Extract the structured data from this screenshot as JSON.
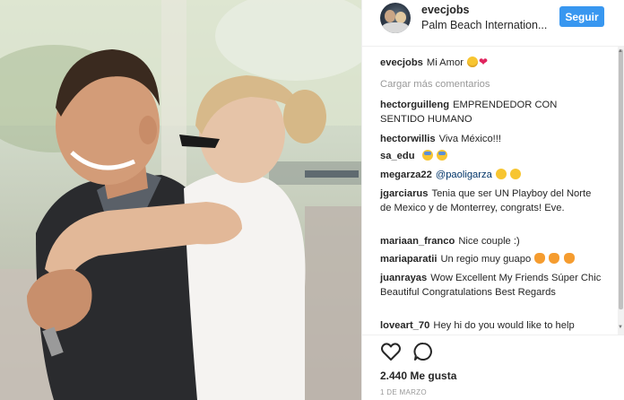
{
  "header": {
    "username": "evecjobs",
    "location": "Palm Beach Internation...",
    "follow_label": "Seguir"
  },
  "caption": {
    "username": "evecjobs",
    "text": "Mi Amor"
  },
  "load_more_label": "Cargar más comentarios",
  "comments": [
    {
      "username": "hectorguilleng",
      "text": "EMPRENDEDOR CON SENTIDO HUMANO"
    },
    {
      "username": "hectorwillis",
      "text": "Viva México!!!"
    },
    {
      "username": "sa_edu",
      "text": ""
    },
    {
      "username": "megarza22",
      "mention": "@paoligarza",
      "text": ""
    },
    {
      "username": "jgarciarus",
      "text": "Tenia que ser UN Playboy del Norte de Mexico y de Monterrey, congrats! Eve."
    },
    {
      "username": "mariaan_franco",
      "text": "Nice couple :)"
    },
    {
      "username": "mariaparatii",
      "text": "Un regio muy guapo"
    },
    {
      "username": "juanrayas",
      "text": "Wow Excellent My Friends Súper Chic Beautiful Congratulations Best Regards"
    },
    {
      "username": "loveart_70",
      "text": "Hey hi do you would like to help"
    }
  ],
  "actions": {
    "like_icon": "heart-icon",
    "comment_icon": "comment-icon"
  },
  "likes_text": "2.440 Me gusta",
  "date_text": "1 DE MARZO",
  "colors": {
    "follow_button": "#3897f0",
    "mention": "#003569",
    "muted": "#999999"
  }
}
